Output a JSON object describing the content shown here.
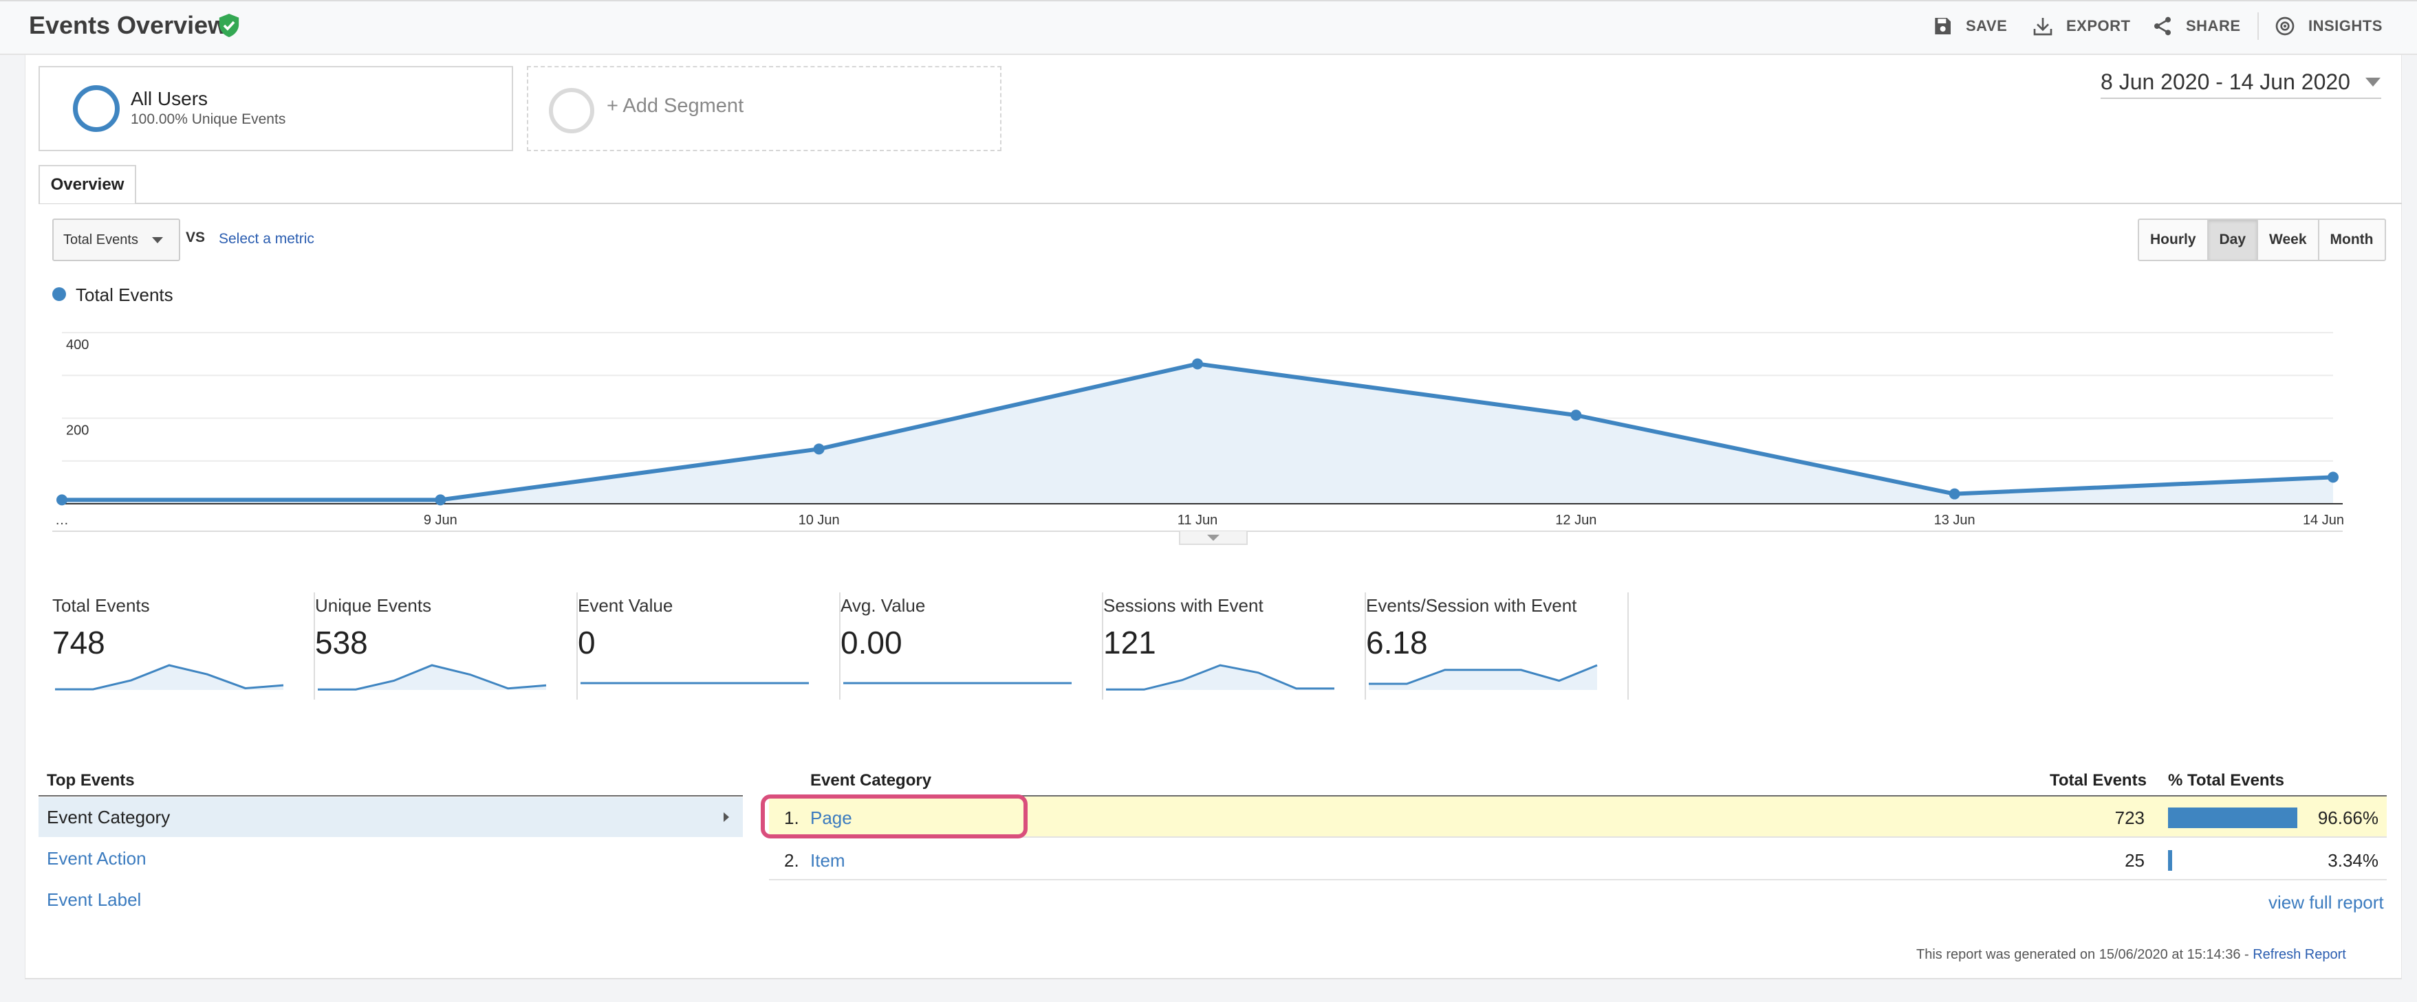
{
  "header": {
    "title": "Events Overview",
    "save": "SAVE",
    "export": "EXPORT",
    "share": "SHARE",
    "insights": "INSIGHTS"
  },
  "segments": {
    "all_users": {
      "name": "All Users",
      "sub": "100.00% Unique Events"
    },
    "add_label": "+ Add Segment"
  },
  "date_range": "8 Jun 2020 - 14 Jun 2020",
  "tabs": [
    "Overview"
  ],
  "metric_selector": {
    "value": "Total Events",
    "vs": "VS",
    "select_metric": "Select a metric"
  },
  "granularity": [
    "Hourly",
    "Day",
    "Week",
    "Month"
  ],
  "granularity_active": "Day",
  "chart_data": {
    "type": "line",
    "series": [
      {
        "name": "Total Events",
        "values": [
          9,
          9,
          128,
          327,
          207,
          23,
          62
        ],
        "color": "#3f85c1"
      }
    ],
    "categories": [
      "…",
      "9 Jun",
      "10 Jun",
      "11 Jun",
      "12 Jun",
      "13 Jun",
      "14 Jun"
    ],
    "y_ticks": [
      "400",
      "200"
    ],
    "ylim": [
      0,
      400
    ],
    "grid": true
  },
  "scorecards": [
    {
      "label": "Total Events",
      "value": "748",
      "spark": [
        9,
        9,
        128,
        327,
        207,
        23,
        62
      ]
    },
    {
      "label": "Unique Events",
      "value": "538",
      "spark": [
        5,
        5,
        90,
        240,
        150,
        15,
        45
      ]
    },
    {
      "label": "Event Value",
      "value": "0",
      "spark": [
        0,
        0,
        0,
        0,
        0,
        0,
        0
      ]
    },
    {
      "label": "Avg. Value",
      "value": "0.00",
      "spark": [
        0,
        0,
        0,
        0,
        0,
        0,
        0
      ]
    },
    {
      "label": "Sessions with Event",
      "value": "121",
      "spark": [
        1,
        1,
        20,
        50,
        35,
        3,
        3
      ]
    },
    {
      "label": "Events/Session with Event",
      "value": "6.18",
      "spark": [
        2,
        2,
        6.5,
        6.5,
        6.5,
        3,
        8
      ]
    }
  ],
  "top_events": {
    "title": "Top Events",
    "items": [
      "Event Category",
      "Event Action",
      "Event Label"
    ]
  },
  "table": {
    "col_category": "Event Category",
    "col_total": "Total Events",
    "col_pct": "% Total Events",
    "rows": [
      {
        "num": "1.",
        "category": "Page",
        "total": "723",
        "pct": "96.66%",
        "share": 0.9666
      },
      {
        "num": "2.",
        "category": "Item",
        "total": "25",
        "pct": "3.34%",
        "share": 0.0334
      }
    ],
    "view_full": "view full report"
  },
  "footer": {
    "note": "This report was generated on 15/06/2020 at 15:14:36 - ",
    "refresh": "Refresh Report"
  }
}
